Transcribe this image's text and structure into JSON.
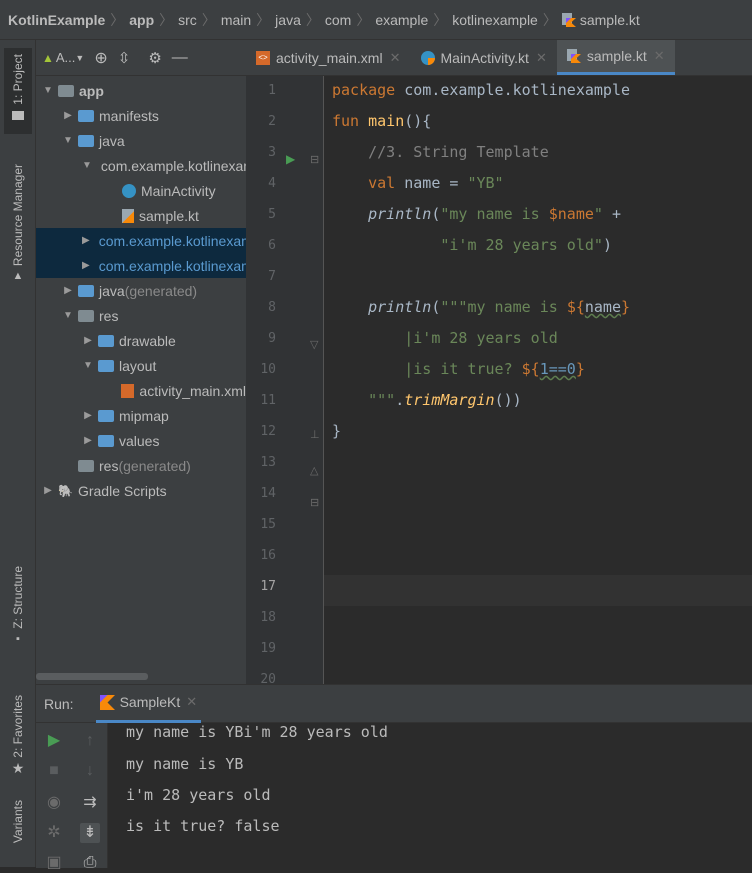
{
  "breadcrumbs": [
    "KotlinExample",
    "app",
    "src",
    "main",
    "java",
    "com",
    "example",
    "kotlinexample",
    "sample.kt"
  ],
  "left_tabs": {
    "project": "1: Project",
    "resource_manager": "Resource Manager",
    "structure": "Z: Structure",
    "favorites": "2: Favorites",
    "variants": "Variants"
  },
  "project_toolbar": {
    "view": "A..."
  },
  "tree": [
    {
      "label": "app",
      "level": 0,
      "arrow": "▼",
      "icon": "module-folder-icon",
      "bold": true
    },
    {
      "label": "manifests",
      "level": 1,
      "arrow": "▶",
      "icon": "folder-icon"
    },
    {
      "label": "java",
      "level": 1,
      "arrow": "▼",
      "icon": "folder-icon"
    },
    {
      "label": "com.example.kotlinexample",
      "level": 2,
      "arrow": "▼",
      "icon": "package-icon"
    },
    {
      "label": "MainActivity",
      "level": 3,
      "arrow": "",
      "icon": "kotlin-class-icon"
    },
    {
      "label": "sample.kt",
      "level": 3,
      "arrow": "",
      "icon": "kotlin-file-icon"
    },
    {
      "label": "com.example.kotlinexample (androidTest)",
      "level": 2,
      "arrow": "▶",
      "icon": "package-icon",
      "selected": true
    },
    {
      "label": "com.example.kotlinexample (test)",
      "level": 2,
      "arrow": "▶",
      "icon": "package-icon",
      "selected": true
    },
    {
      "label": "java",
      "suffix": "(generated)",
      "level": 1,
      "arrow": "▶",
      "icon": "generated-folder-icon"
    },
    {
      "label": "res",
      "level": 1,
      "arrow": "▼",
      "icon": "res-folder-icon"
    },
    {
      "label": "drawable",
      "level": 2,
      "arrow": "▶",
      "icon": "folder-icon"
    },
    {
      "label": "layout",
      "level": 2,
      "arrow": "▼",
      "icon": "folder-icon"
    },
    {
      "label": "activity_main.xml",
      "level": 3,
      "arrow": "",
      "icon": "xml-file-icon"
    },
    {
      "label": "mipmap",
      "level": 2,
      "arrow": "▶",
      "icon": "folder-icon"
    },
    {
      "label": "values",
      "level": 2,
      "arrow": "▶",
      "icon": "folder-icon"
    },
    {
      "label": "res",
      "suffix": "(generated)",
      "level": 1,
      "arrow": "",
      "icon": "res-folder-icon"
    },
    {
      "label": "Gradle Scripts",
      "level": 0,
      "arrow": "▶",
      "icon": "gradle-icon"
    }
  ],
  "editor_tabs": [
    {
      "label": "activity_main.xml",
      "icon": "xml-file-icon",
      "active": false
    },
    {
      "label": "MainActivity.kt",
      "icon": "kotlin-class-icon",
      "active": false
    },
    {
      "label": "sample.kt",
      "icon": "kotlin-file-icon",
      "active": true
    }
  ],
  "line_numbers": [
    "1",
    "2",
    "3",
    "4",
    "5",
    "6",
    "7",
    "8",
    "9",
    "10",
    "11",
    "12",
    "13",
    "14",
    "15",
    "16",
    "17",
    "18",
    "19",
    "20"
  ],
  "code": {
    "l1_kw": "package",
    "l1_rest": " com.example.kotlinexample",
    "l2_kw": "fun",
    "l2_fn": " main",
    "l2_rest": "(){",
    "l3": "    //3. String Template",
    "l4_kw": "    val",
    "l4_rest": " name = ",
    "l4_str": "\"YB\"",
    "l5_fn": "    println",
    "l5_p": "(",
    "l5_str": "\"my name is ",
    "l5_var": "$name",
    "l5_str2": "\"",
    "l5_plus": " +",
    "l6_str": "            \"i'm 28 years old\"",
    "l6_p": ")",
    "l8_fn": "    println",
    "l8_p": "(",
    "l8_str": "\"\"\"my name is ",
    "l8_tmpl": "${",
    "l8_var": "name",
    "l8_tmpl2": "}",
    "l9_str": "        |i'm 28 years old",
    "l10_str": "        |is it true? ",
    "l10_tmpl": "${",
    "l10_expr": "1==0",
    "l10_tmpl2": "}",
    "l11_str": "    \"\"\"",
    "l11_dot": ".",
    "l11_fn": "trimMargin",
    "l11_rest": "())",
    "l12": "}"
  },
  "run": {
    "label": "Run:",
    "tab": "SampleKt",
    "output": [
      "my name is YBi'm 28 years old",
      "my name is YB",
      "i'm 28 years old",
      "is it true? false"
    ]
  }
}
